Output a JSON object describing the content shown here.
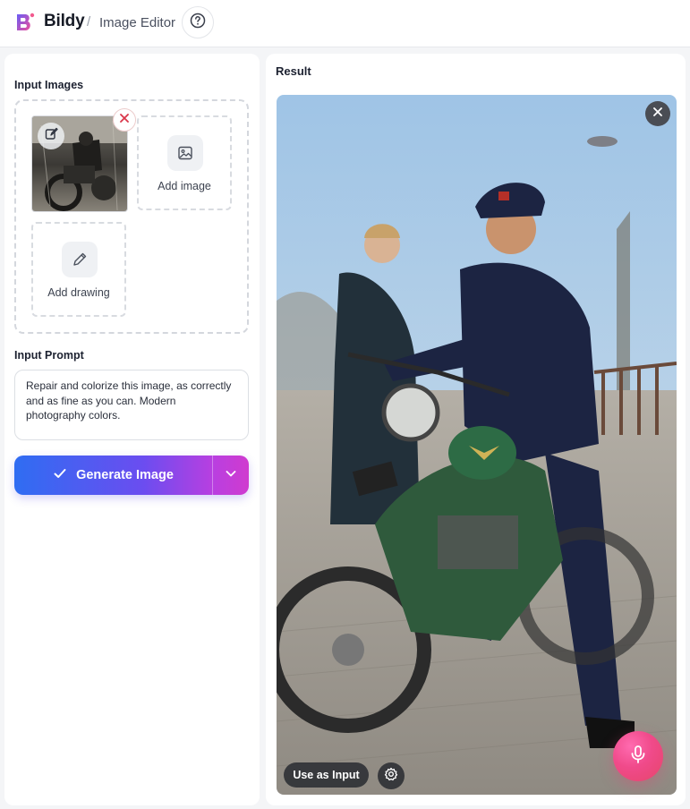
{
  "header": {
    "app_name": "Bildy",
    "separator": "/",
    "page_title": "Image Editor",
    "help_icon": "help-circle-icon"
  },
  "left_panel": {
    "input_images_label": "Input Images",
    "add_image_label": "Add image",
    "add_drawing_label": "Add drawing",
    "input_prompt_label": "Input Prompt",
    "prompt_text": "Repair and colorize this image, as correctly and as fine as you can. Modern photography colors.",
    "generate_label": "Generate Image"
  },
  "right_panel": {
    "result_label": "Result",
    "use_as_input_label": "Use as Input"
  },
  "colors": {
    "accent_start": "#2f6df2",
    "accent_end": "#d03bcf",
    "mic": "#f04a8a"
  }
}
